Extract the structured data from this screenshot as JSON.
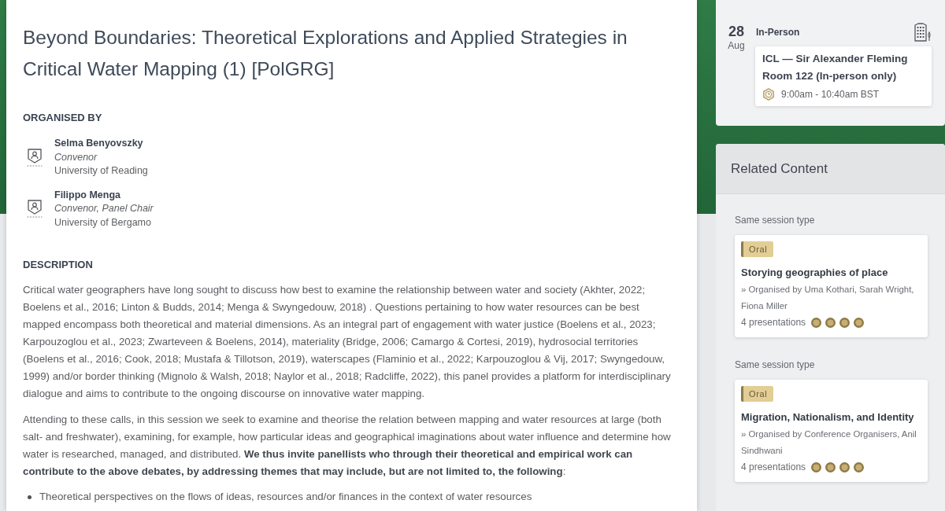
{
  "session": {
    "title": "Beyond Boundaries: Theoretical Explorations and Applied Strategies in Critical Water Mapping (1) [PolGRG]",
    "organisers_heading": "ORGANISED BY",
    "organisers": [
      {
        "name": "Selma Benyovszky",
        "role": "Convenor",
        "affiliation": "University of Reading"
      },
      {
        "name": "Filippo Menga",
        "role": "Convenor, Panel Chair",
        "affiliation": "University of Bergamo"
      }
    ],
    "description_heading": "DESCRIPTION",
    "description": [
      "Critical water geographers have long sought to discuss how best to examine the relationship between water and society (Akhter, 2022; Boelens et al., 2016; Linton & Budds, 2014; Menga & Swyngedouw, 2018) . Questions pertaining to how water resources can be best mapped encompass both theoretical and material dimensions. As an integral part of engagement with water justice (Boelens et al., 2023; Karpouzoglou et al., 2023; Zwarteveen & Boelens, 2014), materiality (Bridge, 2006; Camargo & Cortesi, 2019), hydrosocial territories (Boelens et al., 2016; Cook, 2018; Mustafa & Tillotson, 2019), waterscapes (Flaminio et al., 2022; Karpouzoglou & Vij, 2017; Swyngedouw, 1999) and/or border thinking (Mignolo & Walsh, 2018; Naylor et al., 2018; Radcliffe, 2022), this panel provides a platform for interdisciplinary dialogue and aims to contribute to the ongoing discourse on innovative water mapping.",
      "Attending to these calls, in this session we seek to examine and theorise the relation between mapping and water resources at large (both salt- and freshwater), examining, for example, how particular ideas and geographical imaginations about water influence and determine how water is researched, managed, and distributed. **We thus invite panellists who through their theoretical and empirical work can contribute to the above debates, by addressing themes that may include, but are not limited to, the following**:"
    ],
    "themes": [
      "Theoretical perspectives on the flows of ideas, resources and/or finances in the context of water resources"
    ]
  },
  "schedule": {
    "day": "28",
    "month": "Aug",
    "mode": "In-Person",
    "venue": "ICL — Sir Alexander Fleming Room 122 (In-person only)",
    "time": "9:00am - 10:40am BST"
  },
  "related": {
    "title": "Related Content",
    "items": [
      {
        "group": "Same session type",
        "tag": "Oral",
        "title": "Storying geographies of place",
        "organisers": "» Organised by Uma Kothari, Sarah Wright, Fiona Miller",
        "count": "4 presentations",
        "stars": 4
      },
      {
        "group": "Same session type",
        "tag": "Oral",
        "title": "Migration, Nationalism, and Identity",
        "organisers": "» Organised by Conference Organisers, Anil Sindhwani",
        "count": "4 presentations",
        "stars": 4
      }
    ]
  }
}
